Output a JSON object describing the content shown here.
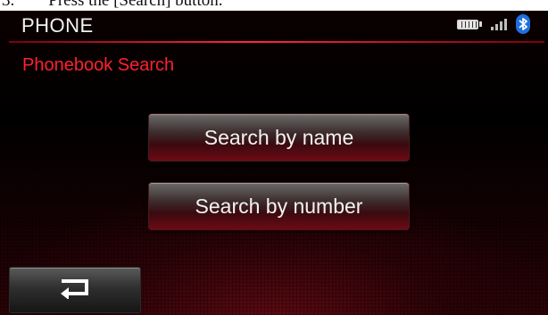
{
  "caption": {
    "text": "3.        Press the [Search] button."
  },
  "header": {
    "title": "PHONE"
  },
  "status_bar": {
    "icons": [
      "battery-icon",
      "signal-icon",
      "bluetooth-icon"
    ]
  },
  "section": {
    "title": "Phonebook Search"
  },
  "menu": {
    "search_by_name": "Search by name",
    "search_by_number": "Search by number"
  },
  "nav": {
    "back_icon": "return-arrow-icon"
  },
  "colors": {
    "accent": "#ff2030",
    "bluetooth": "#1f6fe0",
    "background": "#000000"
  }
}
